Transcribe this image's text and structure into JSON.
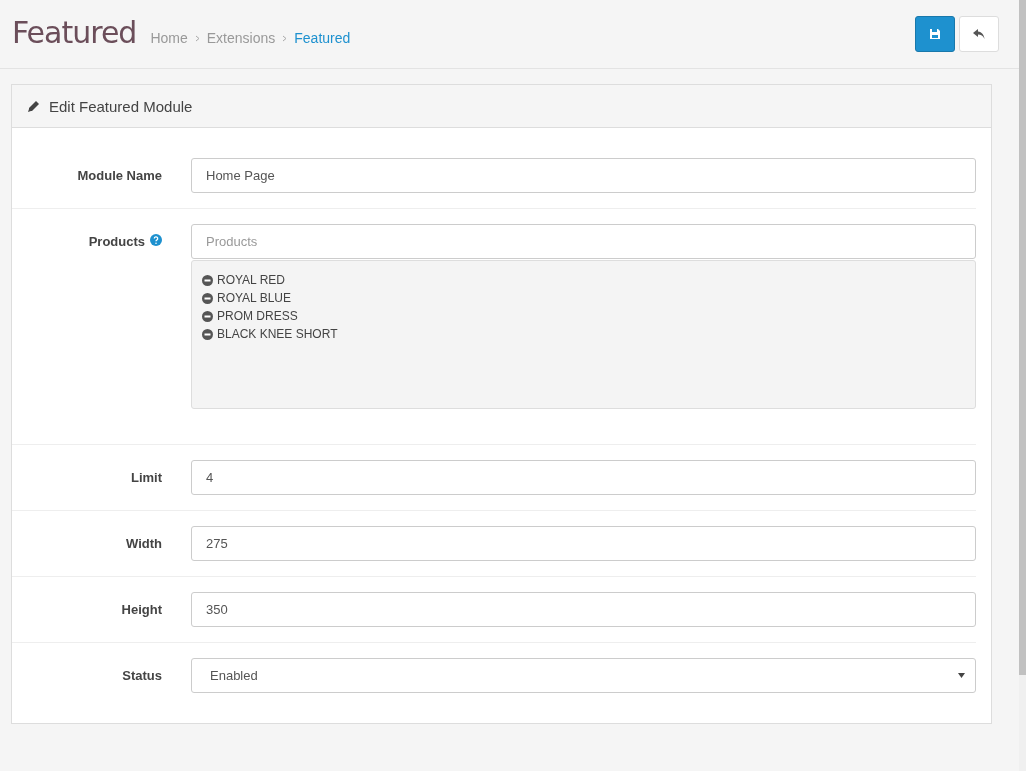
{
  "page_title": "Featured",
  "breadcrumb": [
    {
      "label": "Home",
      "selected": false
    },
    {
      "label": "Extensions",
      "selected": false
    },
    {
      "label": "Featured",
      "selected": true
    }
  ],
  "panel": {
    "title": "Edit Featured Module"
  },
  "fields": [
    {
      "kind": "text",
      "label": "Module Name",
      "value": "Home Page",
      "help": false
    },
    {
      "kind": "products",
      "label": "Products",
      "placeholder": "Products",
      "help": true,
      "items": [
        "ROYAL RED",
        "ROYAL BLUE",
        "PROM DRESS",
        "BLACK KNEE SHORT"
      ]
    },
    {
      "kind": "text",
      "label": "Limit",
      "value": "4",
      "help": false
    },
    {
      "kind": "text",
      "label": "Width",
      "value": "275",
      "help": false
    },
    {
      "kind": "text",
      "label": "Height",
      "value": "350",
      "help": false
    },
    {
      "kind": "select",
      "label": "Status",
      "value": "Enabled",
      "help": false
    }
  ]
}
